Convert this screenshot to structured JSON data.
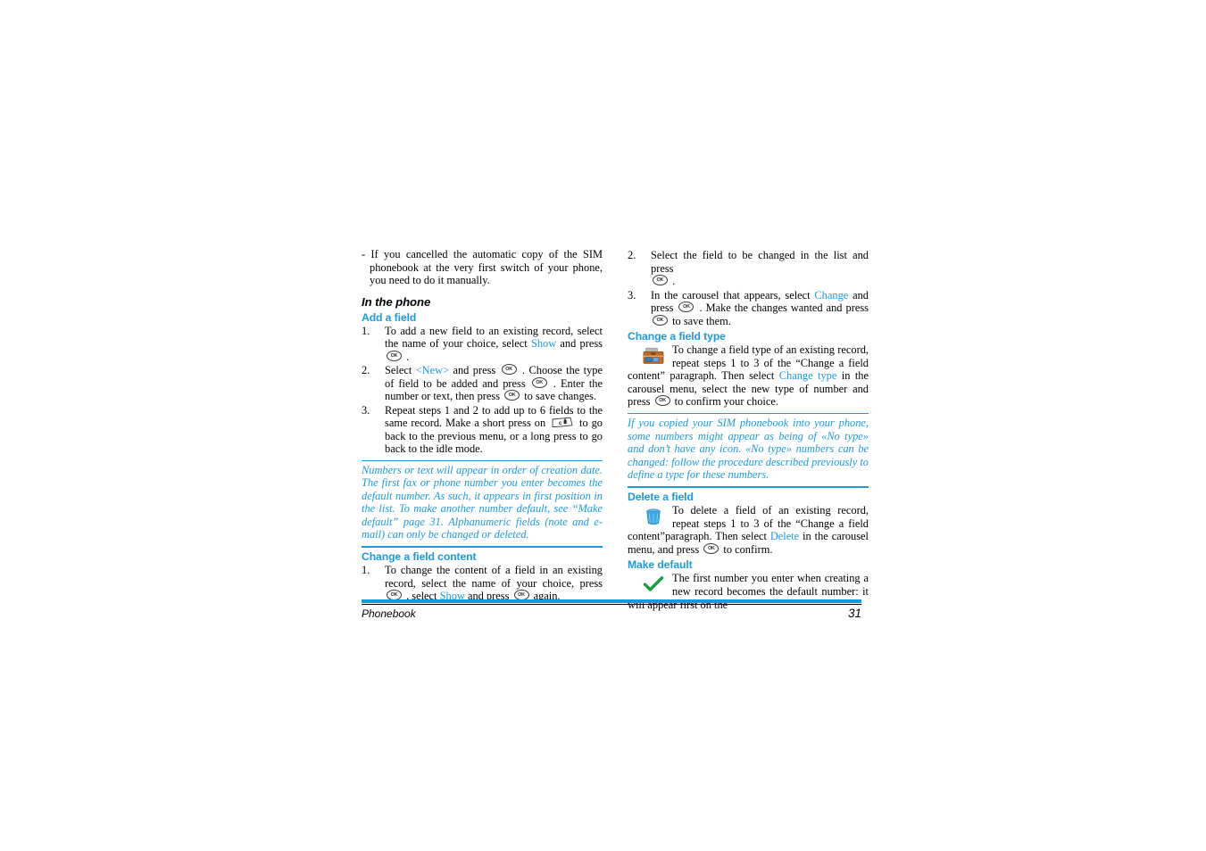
{
  "document": {
    "footer": {
      "title": "Phonebook",
      "page_number": "31"
    },
    "accent_color": "#1b9ae0",
    "footer_bar_color": "#0d9ddb"
  },
  "left_column": {
    "intro_dash_item": "- If you cancelled the automatic copy of the SIM phonebook at the very first switch of your phone, you need to do it manually.",
    "section_heading": "In the phone",
    "add_a_field": {
      "heading": "Add a field",
      "steps": [
        {
          "number": "1.",
          "text_before_link": "To add a new field to an existing record, select the name of your choice, select ",
          "link": "Show",
          "text_after_link": " and press ",
          "key": "OK",
          "text_end": " ."
        },
        {
          "number": "2.",
          "part1_pre": "Select ",
          "part1_link": "<New>",
          "part1_post": " and press ",
          "part2": " . Choose the type of field to be added and press ",
          "part3": " . Enter the number or text, then press ",
          "part4": " to save changes."
        },
        {
          "number": "3.",
          "part1": "Repeat steps 1 and 2 to add up to 6 fields to the same record. Make a short press on ",
          "part2": " to go back to the previous menu, or a long press to go back to the idle mode."
        }
      ]
    },
    "note": "Numbers or text will appear in order of creation date. The first fax or phone number you enter becomes the default number. As such, it appears in first position in the list. To make another number default, see “Make default” page 31. Alphanumeric fields (note and e-mail) can only be changed or deleted.",
    "change_a_field_content": {
      "heading": "Change a field content",
      "step": {
        "number": "1.",
        "part1": "To change the content of a field in an existing record, select the name of your choice, press ",
        "part2": " , select ",
        "link": "Show",
        "part3": " and press ",
        "part4": " again."
      }
    }
  },
  "right_column": {
    "change_content_steps": [
      {
        "number": "2.",
        "part1": "Select the field to be changed in the list and press ",
        "part2": " ."
      },
      {
        "number": "3.",
        "part1": "In the carousel that appears, select ",
        "link": "Change",
        "part2": " and press ",
        "part3": " . Make the changes wanted and press ",
        "part4": " to save them."
      }
    ],
    "change_a_field_type": {
      "heading": "Change a field type",
      "icon": "briefcase-icon",
      "body_part1": "To change a field type of an existing record, repeat steps 1 to 3 of the “Change a field content” paragraph. Then select ",
      "link": "Change type",
      "body_part2": " in the carousel menu, select the new type of number and press ",
      "body_part3": " to confirm your choice."
    },
    "note": "If you copied your SIM phonebook into your phone, some numbers might appear as being of «No type» and don’t have any icon. «No type» numbers can be changed: follow the procedure described previously to define a type for these numbers.",
    "delete_a_field": {
      "heading": "Delete a field",
      "icon": "trash-icon",
      "body_part1": "To delete a field of an existing record, repeat steps 1 to 3 of the “Change a field content”paragraph. Then select ",
      "link": "Delete",
      "body_part2": " in the carousel menu, and press ",
      "body_part3": " to confirm."
    },
    "make_default": {
      "heading": "Make default",
      "icon": "green-check-icon",
      "body": "The first number you enter when creating a new record becomes the default number: it will appear first on the"
    }
  },
  "icons": {
    "ok_key_label": "OK",
    "clr_key_label": "c"
  }
}
